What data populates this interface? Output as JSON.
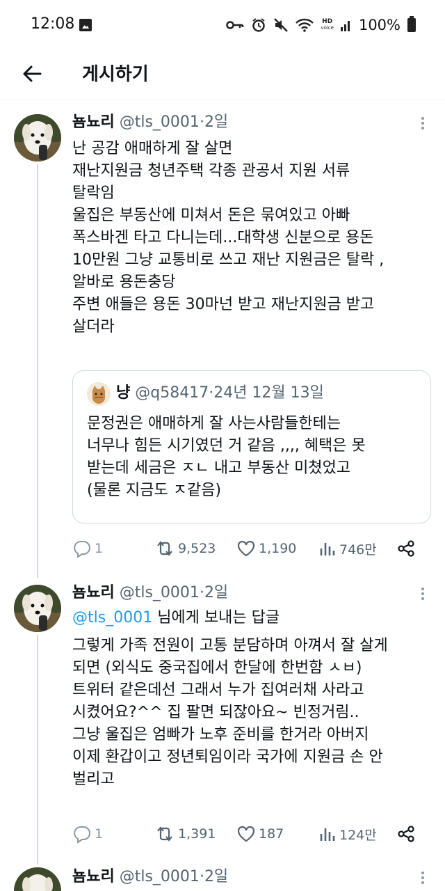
{
  "status_bar": {
    "time": "12:08",
    "hd_top": "HD",
    "hd_bottom": "voice",
    "battery_percent": "100%",
    "icons": [
      "gallery-icon",
      "key-icon",
      "alarm-icon",
      "mute-icon",
      "wifi-icon",
      "signal-icon",
      "battery-icon"
    ]
  },
  "header": {
    "title": "게시하기",
    "back_icon": "arrow-left-icon"
  },
  "tweets": [
    {
      "display_name": "뇸뇨리",
      "handle": "@tls_0001",
      "separator": "·",
      "time": "2일",
      "lines": [
        "난 공감 애매하게 잘 살면",
        "재난지원금 청년주택 각종 관공서 지원 서류",
        "탈락임",
        "울집은 부동산에 미쳐서 돈은 묶여있고 아빠",
        "폭스바겐 타고 다니는데...대학생 신분으로 용돈",
        "10만원 그냥 교통비로 쓰고 재난 지원금은 탈락 ,",
        "알바로 용돈충당",
        "주변 애들은 용돈 30마넌 받고 재난지원금 받고",
        "살더라"
      ],
      "quote": {
        "display_name": "냥",
        "handle": "@q58417",
        "separator": "·",
        "time": "24년 12월 13일",
        "lines": [
          "문정권은 애매하게 잘 사는사람들한테는",
          "너무나 힘든 시기였던 거 같음 ,,,, 혜택은 못",
          "받는데 세금은 ㅈㄴ 내고 부동산 미쳤었고",
          "(물론 지금도 ㅈ같음)"
        ]
      },
      "stats": {
        "replies": "1",
        "retweets": "9,523",
        "likes": "1,190",
        "views": "746만"
      }
    },
    {
      "display_name": "뇸뇨리",
      "handle": "@tls_0001",
      "separator": "·",
      "time": "2일",
      "reply_to": "@tls_0001",
      "reply_suffix": " 님에게 보내는 답글",
      "lines": [
        "그렇게 가족 전원이 고통 분담하며 아껴서 잘 살게",
        "되면 (외식도 중국집에서 한달에 한번함 ㅅㅂ)",
        "트위터 같은데선 그래서 누가 집여러채 사라고",
        "시켰어요?^^ 집 팔면 되잖아요~ 빈정거림..",
        "그냥 울집은 엄빠가 노후 준비를 한거라 아버지",
        "이제 환갑이고 정년퇴임이라 국가에 지원금 손 안",
        "벌리고"
      ],
      "stats": {
        "replies": "1",
        "retweets": "1,391",
        "likes": "187",
        "views": "124만"
      }
    },
    {
      "display_name": "뇸뇨리",
      "handle": "@tls_0001",
      "separator": "·",
      "time": "2일"
    }
  ],
  "colors": {
    "text": "#0f1419",
    "secondary": "#536471",
    "link": "#1d9bf0",
    "border": "#cfd9de"
  }
}
